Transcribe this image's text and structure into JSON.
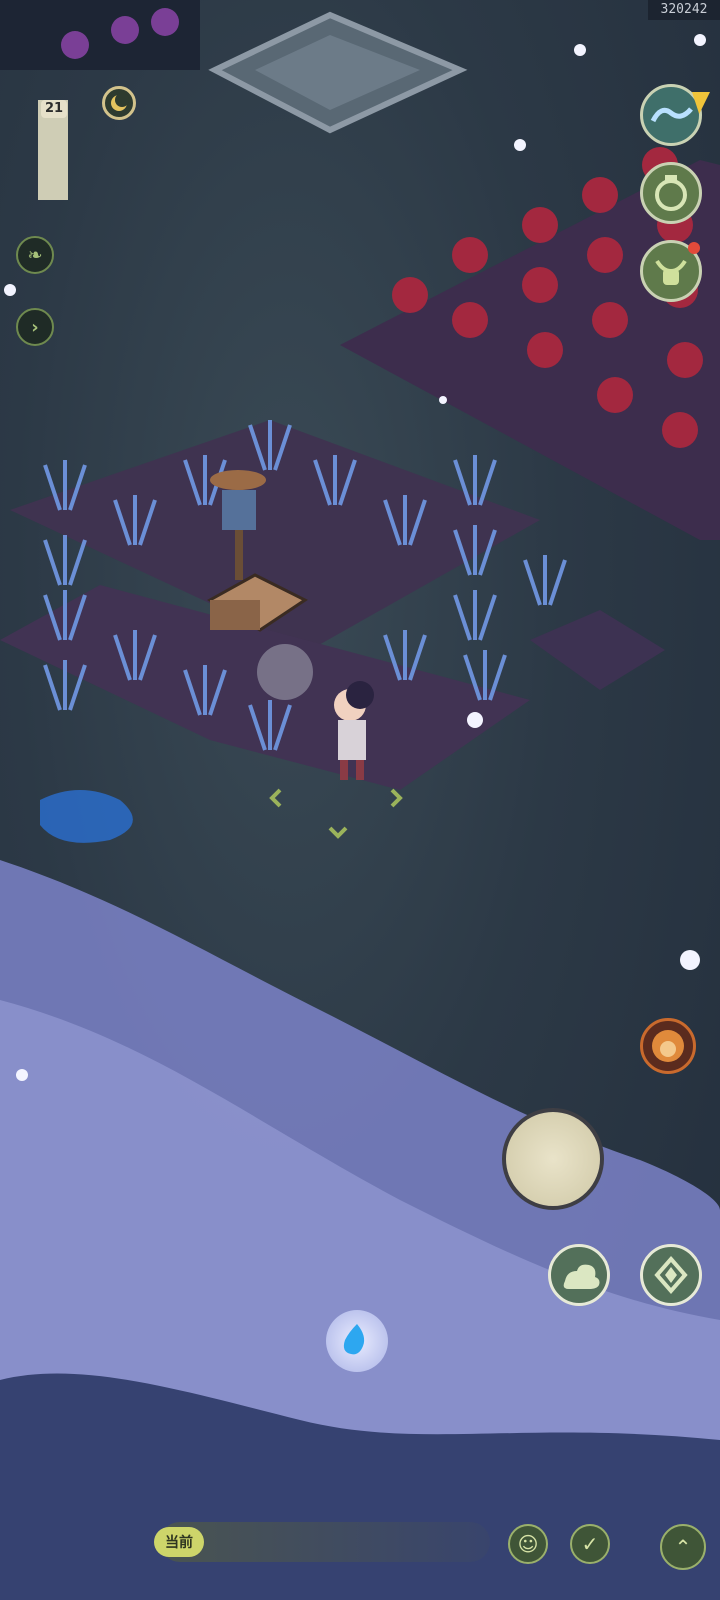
{
  "hud": {
    "user_id": "320242",
    "day_counter": "21"
  },
  "chat": {
    "channel_chip": "当前",
    "emoji_icon": "smile-icon",
    "quick_icon": "sparkle-check-icon",
    "expand_icon": "chevron-up-icon"
  },
  "icons": {
    "left_menu": [
      "leaf-icon",
      "chevron-right-icon"
    ],
    "right_menu": [
      "wave-icon",
      "pot-icon",
      "ox-head-icon"
    ],
    "action": [
      "cloud-icon",
      "diamond-compass-icon",
      "spirit-flame-icon"
    ]
  },
  "colors": {
    "accent_green": "#5f7a4b",
    "badge_red": "#e24a3a",
    "mist_blue": "#7b83c8"
  }
}
